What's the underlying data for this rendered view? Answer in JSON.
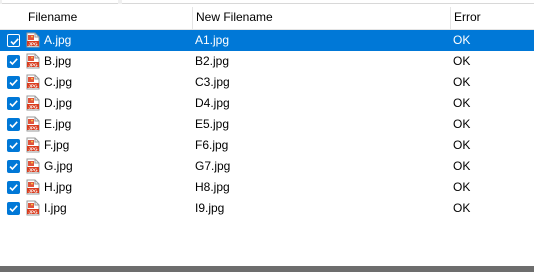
{
  "columns": {
    "filename": "Filename",
    "new_filename": "New Filename",
    "error": "Error"
  },
  "rows": [
    {
      "filename": "A.jpg",
      "new_filename": "A1.jpg",
      "error": "OK",
      "checked": true,
      "selected": true
    },
    {
      "filename": "B.jpg",
      "new_filename": "B2.jpg",
      "error": "OK",
      "checked": true,
      "selected": false
    },
    {
      "filename": "C.jpg",
      "new_filename": "C3.jpg",
      "error": "OK",
      "checked": true,
      "selected": false
    },
    {
      "filename": "D.jpg",
      "new_filename": "D4.jpg",
      "error": "OK",
      "checked": true,
      "selected": false
    },
    {
      "filename": "E.jpg",
      "new_filename": "E5.jpg",
      "error": "OK",
      "checked": true,
      "selected": false
    },
    {
      "filename": "F.jpg",
      "new_filename": "F6.jpg",
      "error": "OK",
      "checked": true,
      "selected": false
    },
    {
      "filename": "G.jpg",
      "new_filename": "G7.jpg",
      "error": "OK",
      "checked": true,
      "selected": false
    },
    {
      "filename": "H.jpg",
      "new_filename": "H8.jpg",
      "error": "OK",
      "checked": true,
      "selected": false
    },
    {
      "filename": "I.jpg",
      "new_filename": "I9.jpg",
      "error": "OK",
      "checked": true,
      "selected": false
    }
  ],
  "icons": {
    "file": "jpg-file-icon",
    "checkbox": "checkbox-checked-icon"
  },
  "colors": {
    "selection": "#0078d7",
    "checkbox": "#0078d7",
    "header_border": "#e5e5e5",
    "scrollbar": "#6d6d6d"
  }
}
